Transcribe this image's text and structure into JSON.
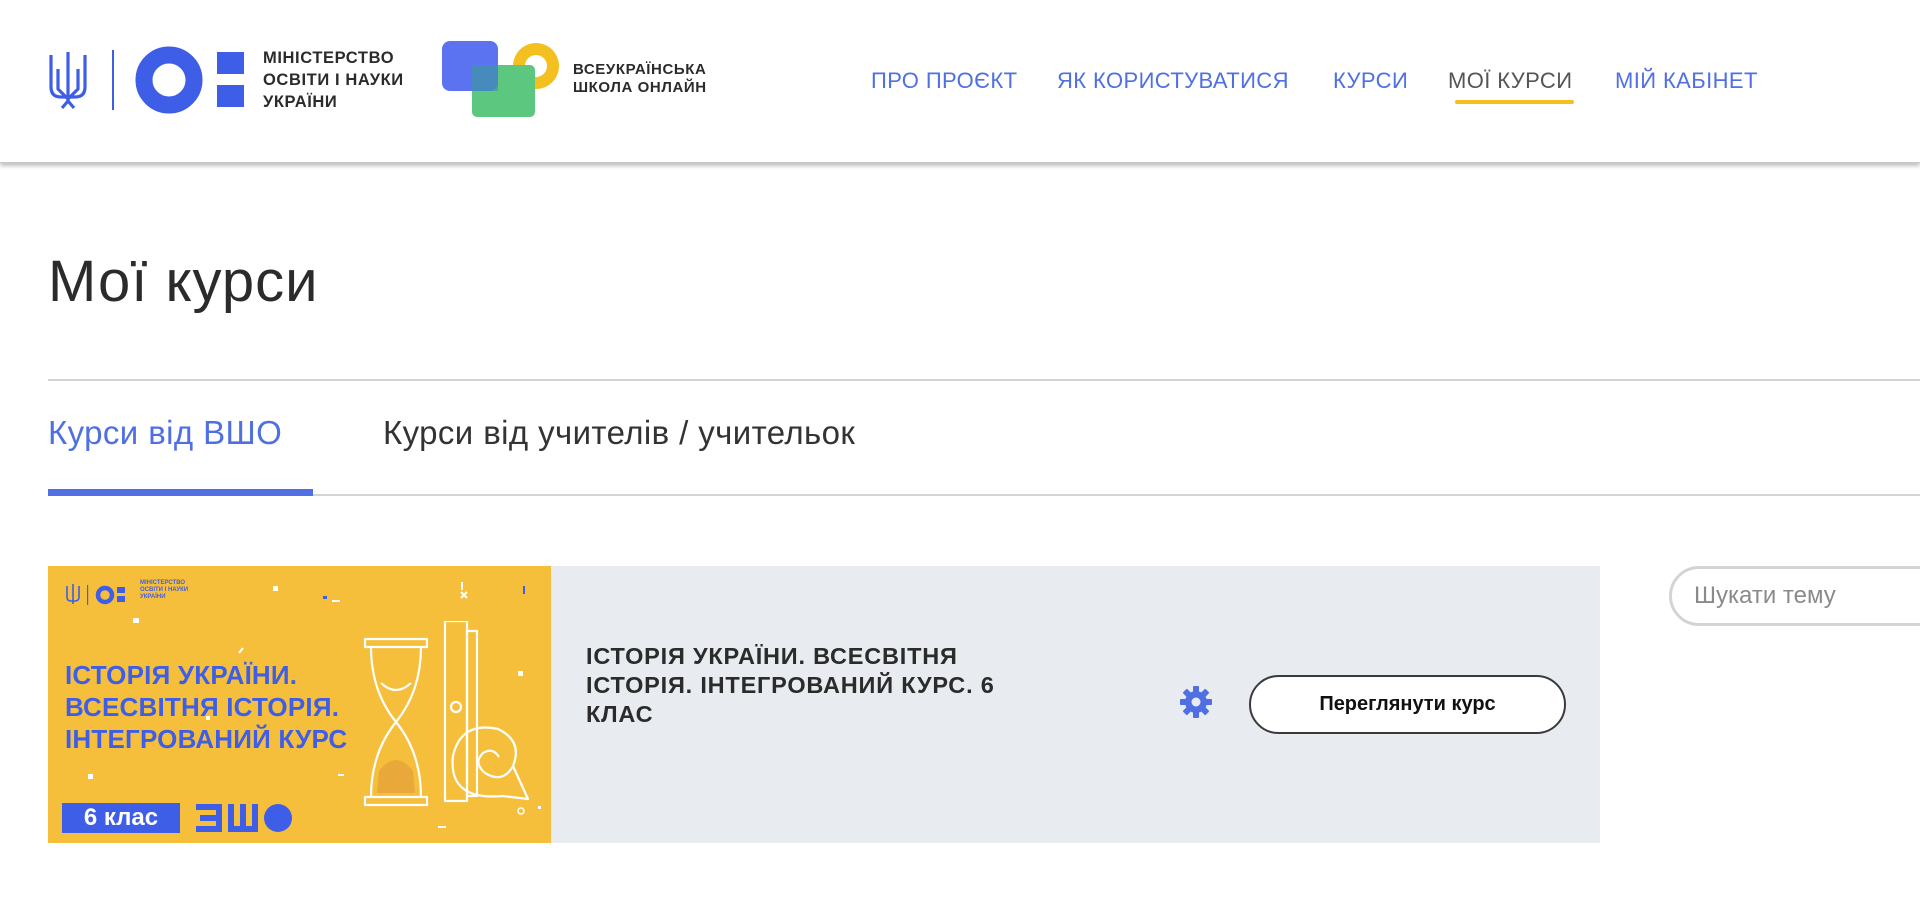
{
  "header": {
    "ministry_logo_lines": [
      "МІНІСТЕРСТВО",
      "ОСВІТИ І НАУКИ",
      "УКРАЇНИ"
    ],
    "school_logo_lines": [
      "ВСЕУКРАЇНСЬКА",
      "ШКОЛА ОНЛАЙН"
    ],
    "nav": [
      {
        "label": "ПРО ПРОЄКТ"
      },
      {
        "label": "ЯК КОРИСТУВАТИСЯ"
      },
      {
        "label": "КУРСИ"
      },
      {
        "label": "МОЇ КУРСИ",
        "active": true
      },
      {
        "label": "МІЙ КАБІНЕТ"
      }
    ]
  },
  "page": {
    "title": "Мої курси"
  },
  "tabs": [
    {
      "label": "Курси від ВШО",
      "active": true
    },
    {
      "label": "Курси від учителів / учительок",
      "active": false
    }
  ],
  "course": {
    "thumbnail": {
      "ministry_lines": [
        "МІНІСТЕРСТВО",
        "ОСВІТИ І НАУКИ",
        "УКРАЇНИ"
      ],
      "title_lines": [
        "ІСТОРІЯ УКРАЇНИ.",
        "ВСЕСВІТНЯ ІСТОРІЯ.",
        "ІНТЕГРОВАНИЙ КУРС"
      ],
      "grade": "6 клас"
    },
    "title": "ІСТОРІЯ УКРАЇНИ. ВСЕСВІТНЯ ІСТОРІЯ. ІНТЕГРОВАНИЙ КУРС. 6 КЛАС",
    "view_button": "Переглянути курс",
    "settings_icon": "gear-icon"
  },
  "search": {
    "placeholder": "Шукати тему"
  },
  "colors": {
    "accent_blue": "#4f6fe3",
    "logo_blue": "#3f5ee8",
    "accent_yellow": "#f4c01f",
    "thumb_yellow": "#f6bf3b",
    "logo_green": "#5cc77f",
    "card_bg": "#e8ecf0"
  }
}
